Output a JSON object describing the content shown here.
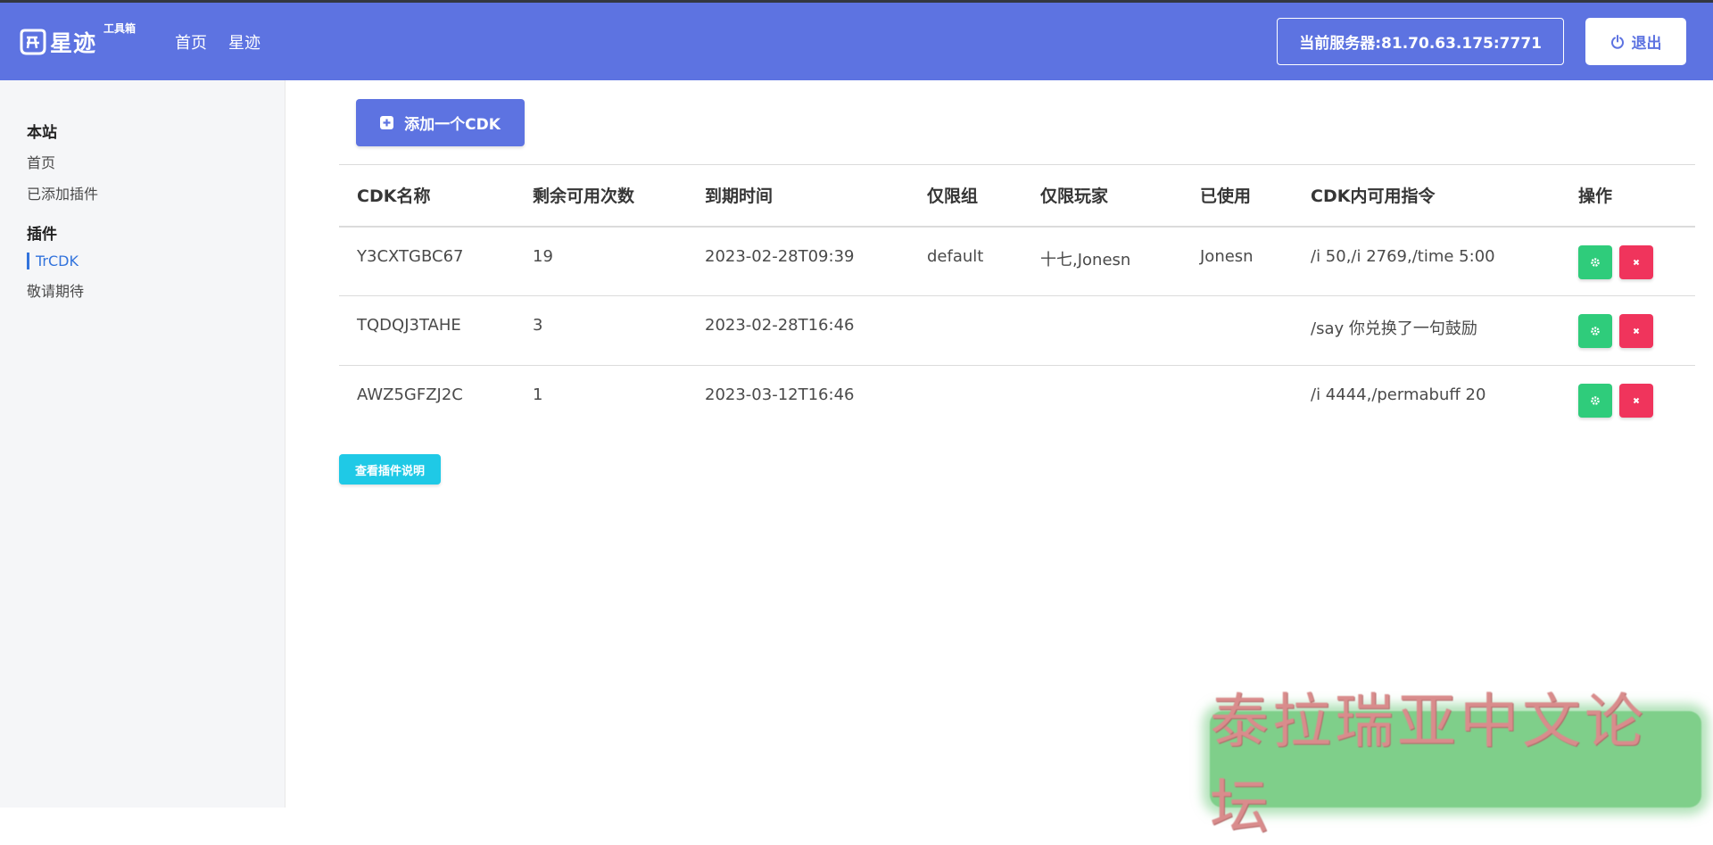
{
  "navbar": {
    "brand_name": "星迹",
    "brand_sub": "工具箱",
    "links": [
      "首页",
      "星迹"
    ],
    "server_label": "当前服务器:81.70.63.175:7771",
    "logout_label": "退出",
    "bg_color": "#5d73e1"
  },
  "sidebar": {
    "sections": [
      {
        "heading": "本站",
        "items": [
          "首页",
          "已添加插件"
        ]
      },
      {
        "heading": "插件",
        "items": [
          "TrCDK",
          "敬请期待"
        ],
        "active": "TrCDK"
      }
    ]
  },
  "main": {
    "add_button_label": "添加一个CDK",
    "doc_button_label": "查看插件说明"
  },
  "table": {
    "headers": [
      "CDK名称",
      "剩余可用次数",
      "到期时间",
      "仅限组",
      "仅限玩家",
      "已使用",
      "CDK内可用指令",
      "操作"
    ],
    "rows": [
      [
        "Y3CXTGBC67",
        "19",
        "2023-02-28T09:39",
        "default",
        "十七,Jonesn",
        "Jonesn",
        "/i 50,/i 2769,/time 5:00"
      ],
      [
        "TQDQJ3TAHE",
        "3",
        "2023-02-28T16:46",
        "",
        "",
        "",
        "/say 你兑换了一句鼓励"
      ],
      [
        "AWZ5GFZJ2C",
        "1",
        "2023-03-12T16:46",
        "",
        "",
        "",
        "/i 4444,/permabuff 20"
      ]
    ]
  },
  "watermark": {
    "text": "泰拉瑞亚中文论坛"
  },
  "icons": {
    "logo": "brand-logo-icon",
    "logout": "power-icon",
    "add": "plus-square-icon",
    "edit": "gear-icon",
    "delete": "close-icon"
  },
  "colors": {
    "primary": "#5d73e1",
    "success": "#2fcc7b",
    "danger": "#f0345c",
    "info": "#1fc9e6",
    "link": "#3273dc"
  }
}
